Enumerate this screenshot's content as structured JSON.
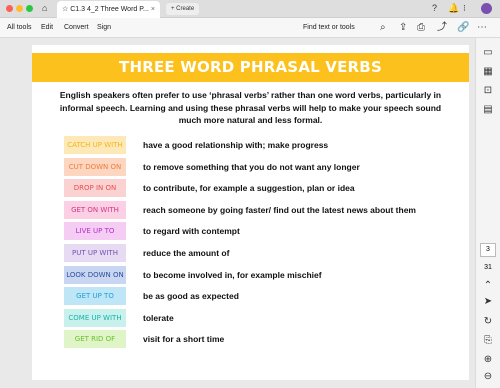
{
  "window": {
    "tab_title": "C1.3 4_2 Three Word P...",
    "tab_close": "×",
    "new_tab_label": "+ Create"
  },
  "toolbar": {
    "menu": [
      "All tools",
      "Edit",
      "Convert",
      "Sign"
    ],
    "find_label": "Find text or tools"
  },
  "sidebar": {
    "page_current": "3",
    "page_total": "31"
  },
  "document": {
    "title": "THREE WORD PHRASAL VERBS",
    "intro": "English speakers often prefer to use ‘phrasal verbs’ rather than one word verbs, particularly in informal speech. Learning and using these phrasal verbs will help to make your speech sound much more natural and less formal.",
    "verbs": [
      {
        "phrase": "CATCH UP WITH",
        "definition": "have a good relationship with; make progress",
        "bg": "#fde8b8",
        "fg": "#f5b519"
      },
      {
        "phrase": "CUT DOWN ON",
        "definition": "to remove something that you do not want any longer",
        "bg": "#fcd6c0",
        "fg": "#ef7d3c"
      },
      {
        "phrase": "DROP IN ON",
        "definition": "to contribute, for example a suggestion, plan or idea",
        "bg": "#fbd2d2",
        "fg": "#e8504f"
      },
      {
        "phrase": "GET ON WITH",
        "definition": "reach someone by going faster/ find out the latest news about them",
        "bg": "#fbd0e4",
        "fg": "#d63384"
      },
      {
        "phrase": "LIVE UP TO",
        "definition": "to regard with contempt",
        "bg": "#f4ccf4",
        "fg": "#b52fc6"
      },
      {
        "phrase": "PUT UP WITH",
        "definition": "reduce the amount of",
        "bg": "#e6dbf3",
        "fg": "#7a4fb0"
      },
      {
        "phrase": "LOOK DOWN ON",
        "definition": "to become involved in, for example mischief",
        "bg": "#c9d6f2",
        "fg": "#2f4f9a"
      },
      {
        "phrase": "GET UP TO",
        "definition": "be as good as expected",
        "bg": "#bfe6f7",
        "fg": "#1d9fd8"
      },
      {
        "phrase": "COME UP WITH",
        "definition": "tolerate",
        "bg": "#c8f1ee",
        "fg": "#17b3a6"
      },
      {
        "phrase": "GET RID OF",
        "definition": "visit for a short time",
        "bg": "#dff5c8",
        "fg": "#6cbf2a"
      }
    ]
  },
  "icons": {
    "window_controls": [
      "close-dot",
      "minimize-dot",
      "zoom-dot"
    ],
    "accent": "#fcc11c"
  }
}
